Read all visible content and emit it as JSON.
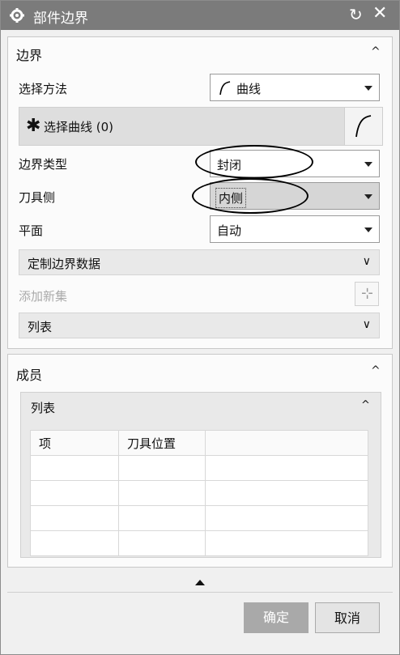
{
  "window": {
    "title": "部件边界",
    "reset_icon": "↻",
    "close_icon": "✕"
  },
  "boundary_section": {
    "title": "边界",
    "select_method": {
      "label": "选择方法",
      "value": "曲线"
    },
    "select_curve": {
      "label": "选择曲线 (0)"
    },
    "boundary_type": {
      "label": "边界类型",
      "value": "封闭"
    },
    "tool_side": {
      "label": "刀具侧",
      "value": "内侧"
    },
    "plane": {
      "label": "平面",
      "value": "自动"
    },
    "custom_data": {
      "label": "定制边界数据"
    },
    "add_set": {
      "label": "添加新集"
    },
    "list": {
      "label": "列表"
    }
  },
  "members_section": {
    "title": "成员",
    "list": {
      "title": "列表",
      "columns": [
        "项",
        "刀具位置",
        ""
      ],
      "rows": [
        [
          "",
          "",
          ""
        ],
        [
          "",
          "",
          ""
        ],
        [
          "",
          "",
          ""
        ],
        [
          "",
          "",
          ""
        ]
      ]
    }
  },
  "footer": {
    "ok": "确定",
    "cancel": "取消"
  }
}
